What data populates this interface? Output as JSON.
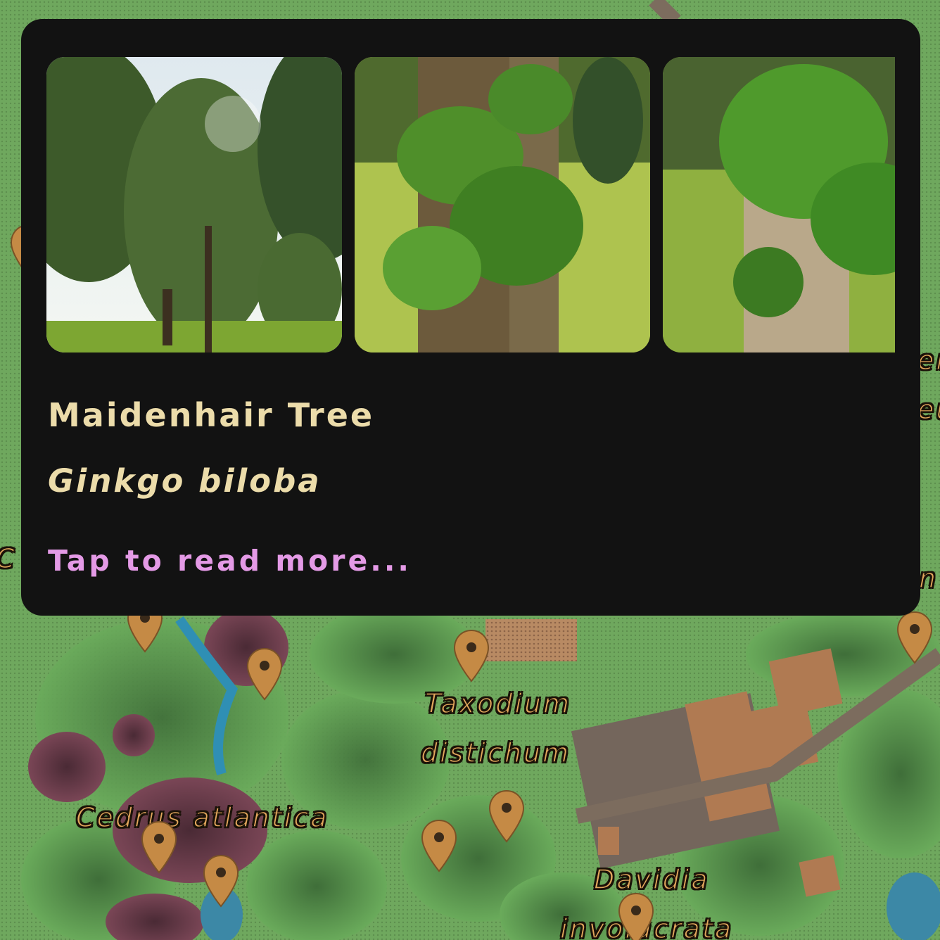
{
  "popup": {
    "common_name": "Maidenhair Tree",
    "scientific_name": "Ginkgo biloba",
    "read_more": "Tap to read more..."
  },
  "photos": [
    {
      "icon": "tree-landscape-photo"
    },
    {
      "icon": "ginkgo-leaves-trunk-photo"
    },
    {
      "icon": "ginkgo-leaves-closeup-photo"
    }
  ],
  "map": {
    "labels": {
      "taxodium_line1": "Taxodium",
      "taxodium_line2": "distichum",
      "cedrus": "Cedrus atlantica",
      "davidia_line1": "Davidia",
      "davidia_line2": "involucrata",
      "left_edge_fragment": "C",
      "right_fragment_1": "er",
      "right_fragment_2": "eu",
      "right_fragment_3": "n"
    },
    "colors": {
      "grass": "#5f9b52",
      "pin": "#c58a45",
      "label_fill": "#e2a65c",
      "building": "#b07a52"
    }
  }
}
